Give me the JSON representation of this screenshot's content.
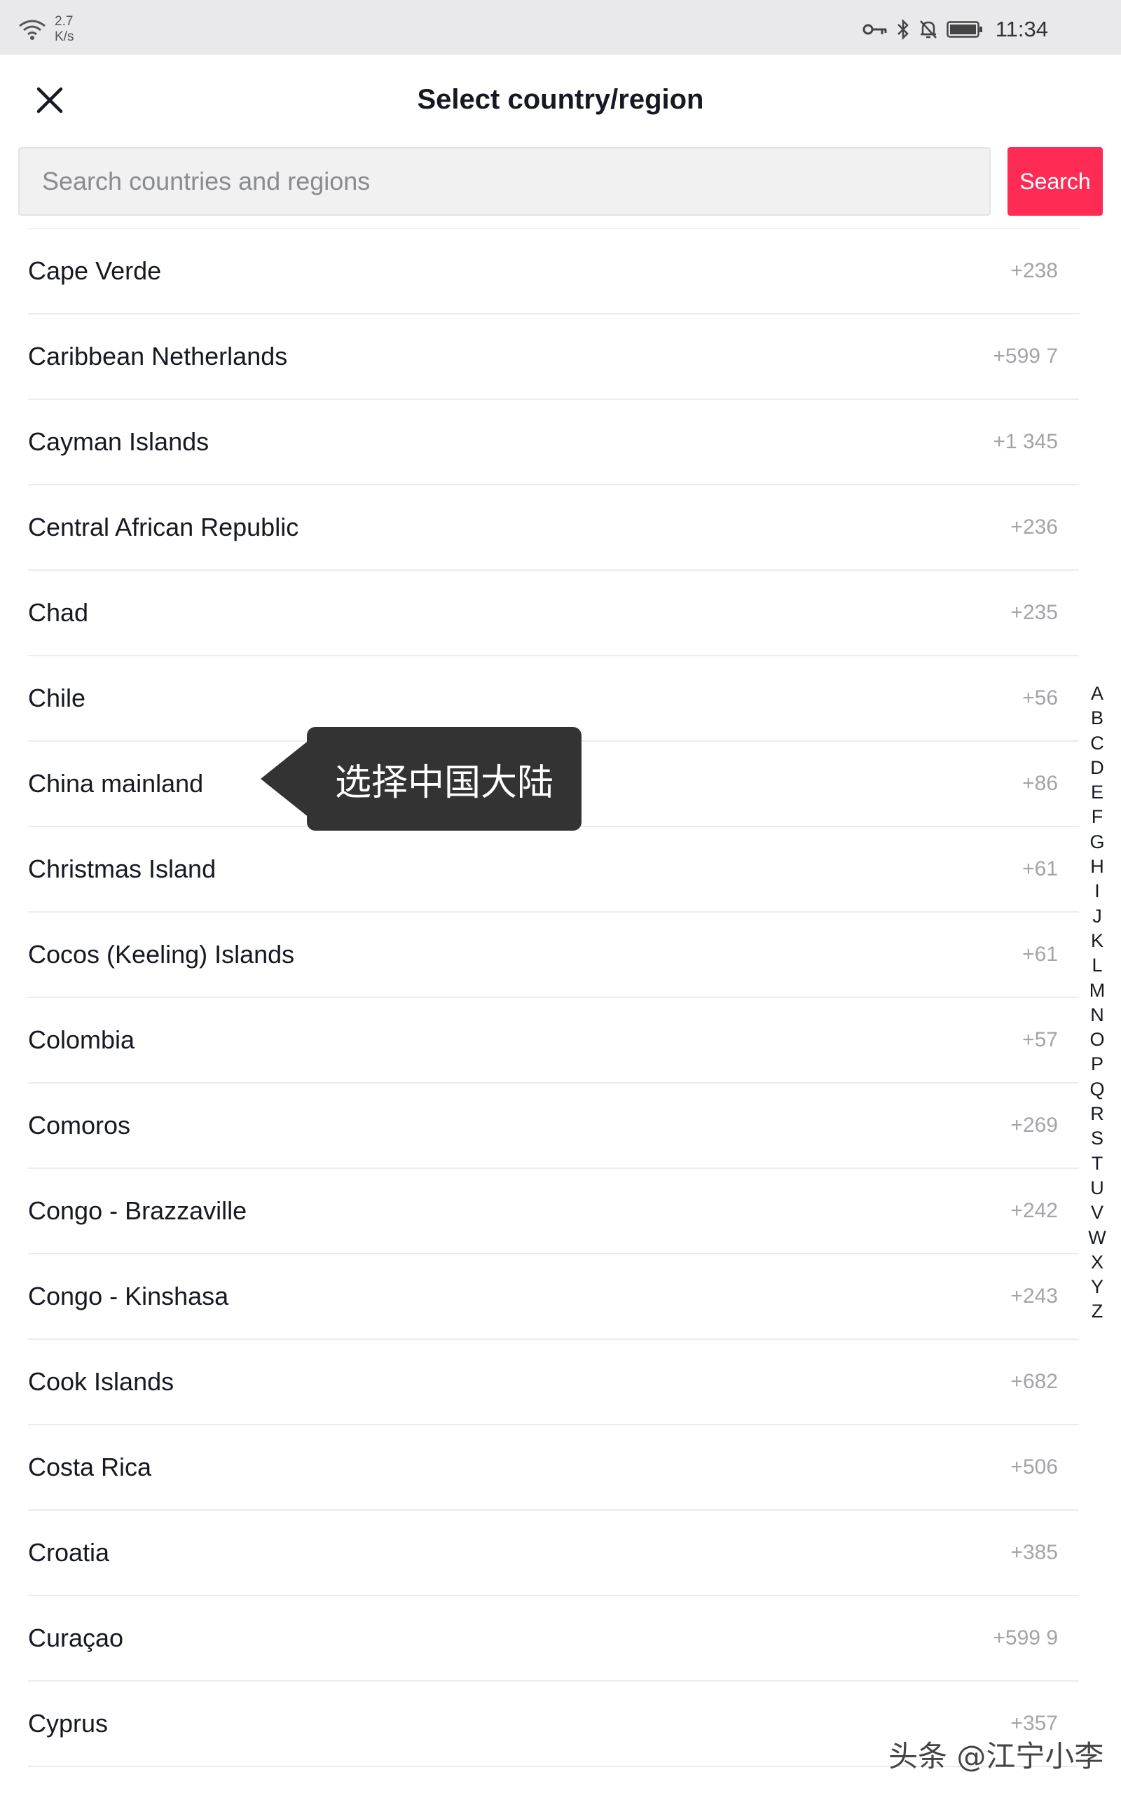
{
  "status_bar": {
    "net_speed_value": "2.7",
    "net_speed_unit": "K/s",
    "time": "11:34",
    "icons": [
      "wifi-icon",
      "vpn-key-icon",
      "bluetooth-icon",
      "mute-bell-icon",
      "battery-icon"
    ]
  },
  "header": {
    "title": "Select country/region",
    "close_icon": "close-icon"
  },
  "search": {
    "placeholder": "Search countries and regions",
    "value": "",
    "button_label": "Search"
  },
  "countries": [
    {
      "name": "Cape Verde",
      "code": "+238"
    },
    {
      "name": "Caribbean Netherlands",
      "code": "+599 7"
    },
    {
      "name": "Cayman Islands",
      "code": "+1 345"
    },
    {
      "name": "Central African Republic",
      "code": "+236"
    },
    {
      "name": "Chad",
      "code": "+235"
    },
    {
      "name": "Chile",
      "code": "+56"
    },
    {
      "name": "China mainland",
      "code": "+86"
    },
    {
      "name": "Christmas Island",
      "code": "+61"
    },
    {
      "name": "Cocos (Keeling) Islands",
      "code": "+61"
    },
    {
      "name": "Colombia",
      "code": "+57"
    },
    {
      "name": "Comoros",
      "code": "+269"
    },
    {
      "name": "Congo - Brazzaville",
      "code": "+242"
    },
    {
      "name": "Congo - Kinshasa",
      "code": "+243"
    },
    {
      "name": "Cook Islands",
      "code": "+682"
    },
    {
      "name": "Costa Rica",
      "code": "+506"
    },
    {
      "name": "Croatia",
      "code": "+385"
    },
    {
      "name": "Curaçao",
      "code": "+599 9"
    },
    {
      "name": "Cyprus",
      "code": "+357"
    }
  ],
  "alphabet": [
    "A",
    "B",
    "C",
    "D",
    "E",
    "F",
    "G",
    "H",
    "I",
    "J",
    "K",
    "L",
    "M",
    "N",
    "O",
    "P",
    "Q",
    "R",
    "S",
    "T",
    "U",
    "V",
    "W",
    "X",
    "Y",
    "Z"
  ],
  "tooltip": {
    "text": "选择中国大陆"
  },
  "watermark": {
    "text": "头条 @江宁小李"
  },
  "colors": {
    "accent": "#fe2c55",
    "tooltip_bg": "#333333",
    "status_bar_bg": "#e9e9ec"
  }
}
